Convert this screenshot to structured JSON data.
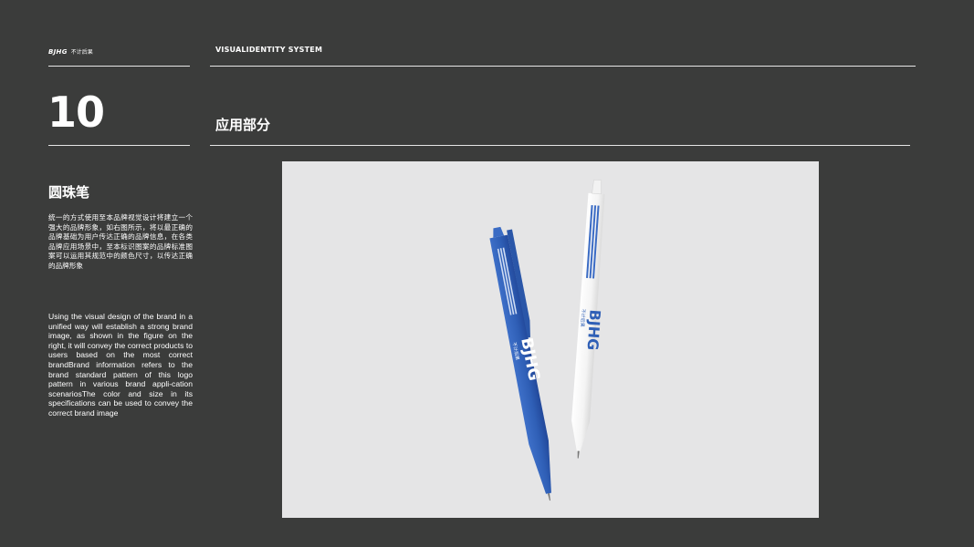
{
  "header": {
    "brand_logo": "BJHG",
    "brand_subtitle": "不计后果",
    "system_title": "VISUALIDENTITY SYSTEM"
  },
  "section": {
    "number": "10",
    "title": "应用部分"
  },
  "item": {
    "title": "圆珠笔",
    "description_cn": "统一的方式使用至本品牌视觉设计将建立一个强大的品牌形象，如右图所示，将以最正确的品牌基础为用户传达正确的品牌信息，在各类品牌应用场景中，至本标识图案的品牌标准图案可以运用其规范中的颜色尺寸，以传达正确的品牌形象",
    "description_en": "Using the visual design of the brand in a unified way will establish a strong brand image, as shown in the figure on the right, it will convey the correct products to users based on the most correct brandBrand information refers to the brand standard pattern of this logo pattern in various brand appli-cation scenariosThe color and size in its specifications can be used to convey the correct brand image"
  },
  "mockup": {
    "pen_logo_text": "BJHG",
    "pen_sub_text": "不计后果",
    "colors": {
      "background": "#3b3c3b",
      "photo_bg": "#e5e5e6",
      "blue_pen": "#2f5fb6",
      "white_pen": "#f7f7f7"
    }
  }
}
